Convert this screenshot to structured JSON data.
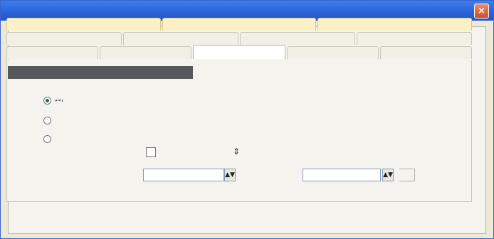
{
  "window": {
    "title": "",
    "close_glyph": "×"
  },
  "tabs": {
    "row1": [
      "",
      "",
      ""
    ],
    "row2": [
      "",
      "",
      "",
      ""
    ],
    "row3": [
      "",
      "",
      "",
      "",
      ""
    ]
  },
  "group": {
    "header": ""
  },
  "options": {
    "items": [
      {
        "label": "",
        "selected": true
      },
      {
        "label": "",
        "selected": false
      },
      {
        "label": "",
        "selected": false
      }
    ]
  },
  "fields": {
    "dpi_label": "",
    "dpi_value": "",
    "dpi_arrow": "⇕",
    "scale_label": "",
    "scale_value": "",
    "scale_spin": "▲▼",
    "units_label": "",
    "units_value": "",
    "units_spin": "▲▼"
  },
  "colors": {
    "titlebar": "#2b64d8",
    "accent_tab": "#fbf1c8",
    "group_header": "#56595c"
  }
}
